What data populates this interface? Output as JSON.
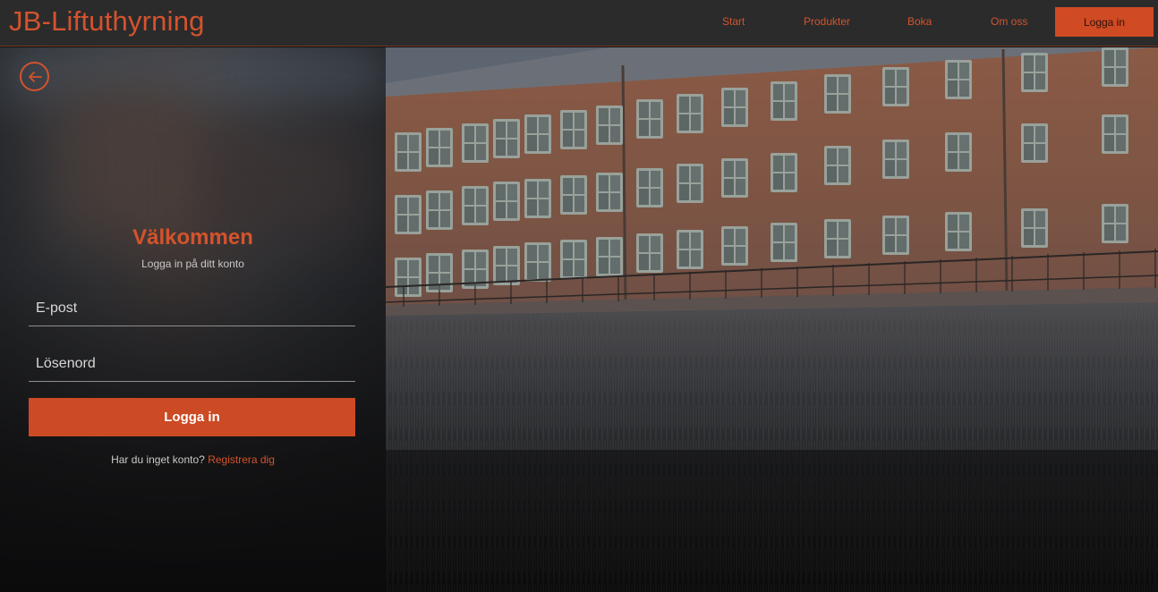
{
  "header": {
    "brand": "JB-Liftuthyrning",
    "nav": {
      "start": "Start",
      "produkter": "Produkter",
      "boka": "Boka",
      "om_oss": "Om oss",
      "logga_in": "Logga in"
    }
  },
  "login": {
    "back_icon": "arrow-left-circle-icon",
    "title": "Välkommen",
    "subtitle": "Logga in på ditt konto",
    "email_placeholder": "E-post",
    "password_placeholder": "Lösenord",
    "submit_label": "Logga in",
    "register_prompt": "Har du inget konto?",
    "register_link": "Registrera dig"
  },
  "colors": {
    "accent": "#d04a24",
    "header_bg": "#2b2b2c",
    "page_bg": "#0e0e0f"
  }
}
